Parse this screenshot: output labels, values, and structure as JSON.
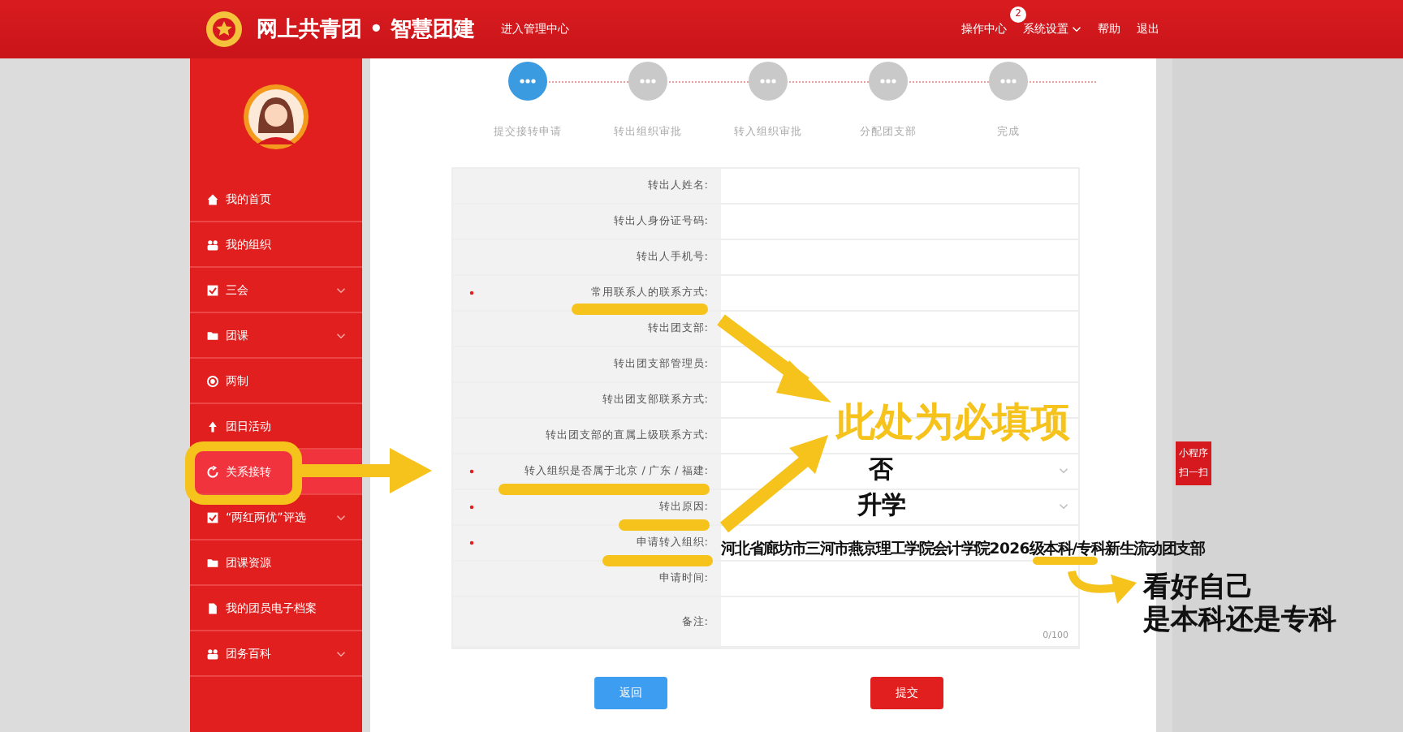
{
  "header": {
    "title": "网上共青团 • 智慧团建",
    "subtitle": "进入管理中心",
    "nav": [
      {
        "label": "操作中心",
        "badge": "2",
        "dropdown": false
      },
      {
        "label": "系统设置",
        "dropdown": true
      },
      {
        "label": "帮助",
        "dropdown": false
      },
      {
        "label": "退出",
        "dropdown": false
      }
    ]
  },
  "sidebar": {
    "items": [
      {
        "label": "我的首页",
        "selected": false,
        "expandable": false
      },
      {
        "label": "我的组织",
        "selected": false,
        "expandable": false
      },
      {
        "label": "三会",
        "selected": false,
        "expandable": true
      },
      {
        "label": "团课",
        "selected": false,
        "expandable": true
      },
      {
        "label": "两制",
        "selected": false,
        "expandable": false
      },
      {
        "label": "团日活动",
        "selected": false,
        "expandable": false
      },
      {
        "label": "关系接转",
        "selected": true,
        "expandable": false
      },
      {
        "label": "“两红两优”评选",
        "selected": false,
        "expandable": true
      },
      {
        "label": "团课资源",
        "selected": false,
        "expandable": false
      },
      {
        "label": "我的团员电子档案",
        "selected": false,
        "expandable": false
      },
      {
        "label": "团务百科",
        "selected": false,
        "expandable": true
      }
    ]
  },
  "steps": [
    {
      "label": "提交接转申请",
      "selected": true
    },
    {
      "label": "转出组织审批",
      "selected": false
    },
    {
      "label": "转入组织审批",
      "selected": false
    },
    {
      "label": "分配团支部",
      "selected": false
    },
    {
      "label": "完成",
      "selected": false
    }
  ],
  "form": {
    "rows": [
      {
        "label": "转出人姓名:",
        "required": false,
        "kind": "text"
      },
      {
        "label": "转出人身份证号码:",
        "required": false,
        "kind": "text"
      },
      {
        "label": "转出人手机号:",
        "required": false,
        "kind": "text"
      },
      {
        "label": "常用联系人的联系方式:",
        "required": true,
        "kind": "text"
      },
      {
        "label": "转出团支部:",
        "required": false,
        "kind": "text"
      },
      {
        "label": "转出团支部管理员:",
        "required": false,
        "kind": "text"
      },
      {
        "label": "转出团支部联系方式:",
        "required": false,
        "kind": "text"
      },
      {
        "label": "转出团支部的直属上级联系方式:",
        "required": false,
        "kind": "text"
      },
      {
        "label": "转入组织是否属于北京 / 广东 / 福建:",
        "required": true,
        "kind": "select"
      },
      {
        "label": "转出原因:",
        "required": true,
        "kind": "select"
      },
      {
        "label": "申请转入组织:",
        "required": true,
        "kind": "text"
      },
      {
        "label": "申请时间:",
        "required": false,
        "kind": "text"
      },
      {
        "label": "备注:",
        "required": false,
        "kind": "textarea",
        "counter": "0/100"
      }
    ],
    "buttons": [
      {
        "label": "返回",
        "kind": "back"
      },
      {
        "label": "提交",
        "kind": "submit"
      }
    ]
  },
  "side_badge": [
    "小程序",
    "扫一扫"
  ],
  "annotations": {
    "required_note": "此处为必填项",
    "answers": [
      "否",
      "升学"
    ],
    "organization": "河北省廊坊市三河市燕京理工学院会计学院2026级本科/专科新生流动团支部",
    "level_note": [
      "看好自己",
      "是本科还是专科"
    ]
  }
}
